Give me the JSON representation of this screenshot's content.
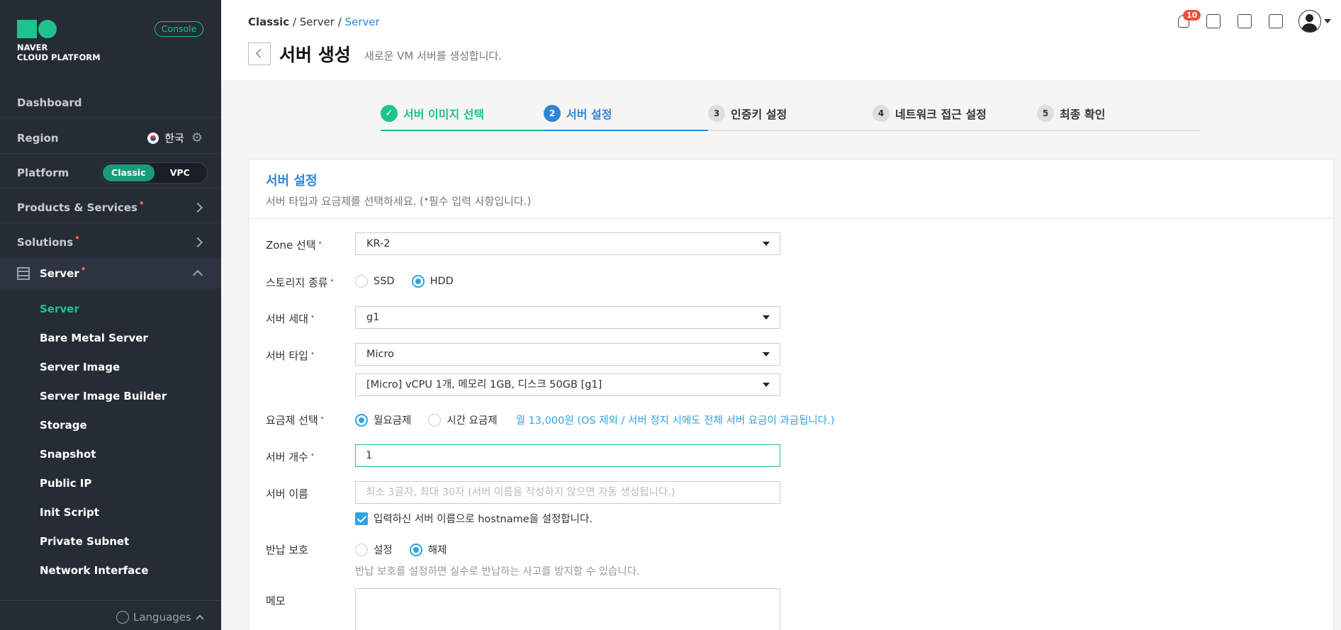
{
  "sidebar": {
    "logo_line1": "NAVER",
    "logo_line2": "CLOUD PLATFORM",
    "console_label": "Console",
    "dashboard": "Dashboard",
    "region_label": "Region",
    "region_value": "한국",
    "platform_label": "Platform",
    "platform_options": [
      "Classic",
      "VPC"
    ],
    "platform_selected": "Classic",
    "products": "Products & Services",
    "solutions": "Solutions",
    "server_section": "Server",
    "submenu": [
      "Server",
      "Bare Metal Server",
      "Server Image",
      "Server Image Builder",
      "Storage",
      "Snapshot",
      "Public IP",
      "Init Script",
      "Private Subnet",
      "Network Interface"
    ],
    "submenu_active": "Server",
    "languages": "Languages",
    "new_dot": "•"
  },
  "header": {
    "breadcrumb": [
      "Classic",
      "Server",
      "Server"
    ],
    "title": "서버 생성",
    "subtitle": "새로운 VM 서버를 생성합니다.",
    "notification_count": "10",
    "icons": [
      "bell-icon",
      "chat-icon",
      "memo-icon",
      "info-book-icon",
      "user-avatar-icon"
    ]
  },
  "stepper": {
    "steps": [
      {
        "num": "✓",
        "label": "서버 이미지 선택",
        "state": "done"
      },
      {
        "num": "2",
        "label": "서버 설정",
        "state": "current"
      },
      {
        "num": "3",
        "label": "인증키 설정",
        "state": "todo"
      },
      {
        "num": "4",
        "label": "네트워크 접근 설정",
        "state": "todo"
      },
      {
        "num": "5",
        "label": "최종 확인",
        "state": "todo"
      }
    ]
  },
  "form": {
    "title": "서버 설정",
    "desc_prefix": "서버 타입과 요금제를 선택하세요. (",
    "desc_suffix": "필수 입력 사항입니다.)",
    "req_mark": "•",
    "zone_label": "Zone 선택",
    "zone_value": "KR-2",
    "storage_label": "스토리지 종류",
    "storage_options": [
      "SSD",
      "HDD"
    ],
    "generation_label": "서버 세대",
    "generation_value": "g1",
    "type_label": "서버 타입",
    "type_value": "Micro",
    "spec_value": "[Micro] vCPU 1개, 메모리 1GB, 디스크 50GB [g1]",
    "plan_label": "요금제 선택",
    "plan_options": [
      "월요금제",
      "시간 요금제"
    ],
    "plan_note": "월 13,000원 (OS 제외 / 서버 정지 시에도 전체 서버 요금이 과금됩니다.)",
    "count_label": "서버 개수",
    "count_value": "1",
    "name_label": "서버 이름",
    "name_placeholder": "최소 3글자, 최대 30자 (서버 이름을 작성하지 않으면 자동 생성됩니다.)",
    "hostname_check": "입력하신 서버 이름으로 hostname을 설정합니다.",
    "protect_label": "반납 보호",
    "protect_options": [
      "설정",
      "해제"
    ],
    "protect_help": "반납 보호를 설정하면 실수로 반납하는 사고를 방지할 수 있습니다.",
    "memo_label": "메모"
  },
  "colors": {
    "sidebar_bg": "#262c36",
    "accent_green": "#1fc28d",
    "accent_blue": "#2e86d6",
    "radio_blue": "#2ea3e0",
    "badge_red": "#f04e37"
  }
}
